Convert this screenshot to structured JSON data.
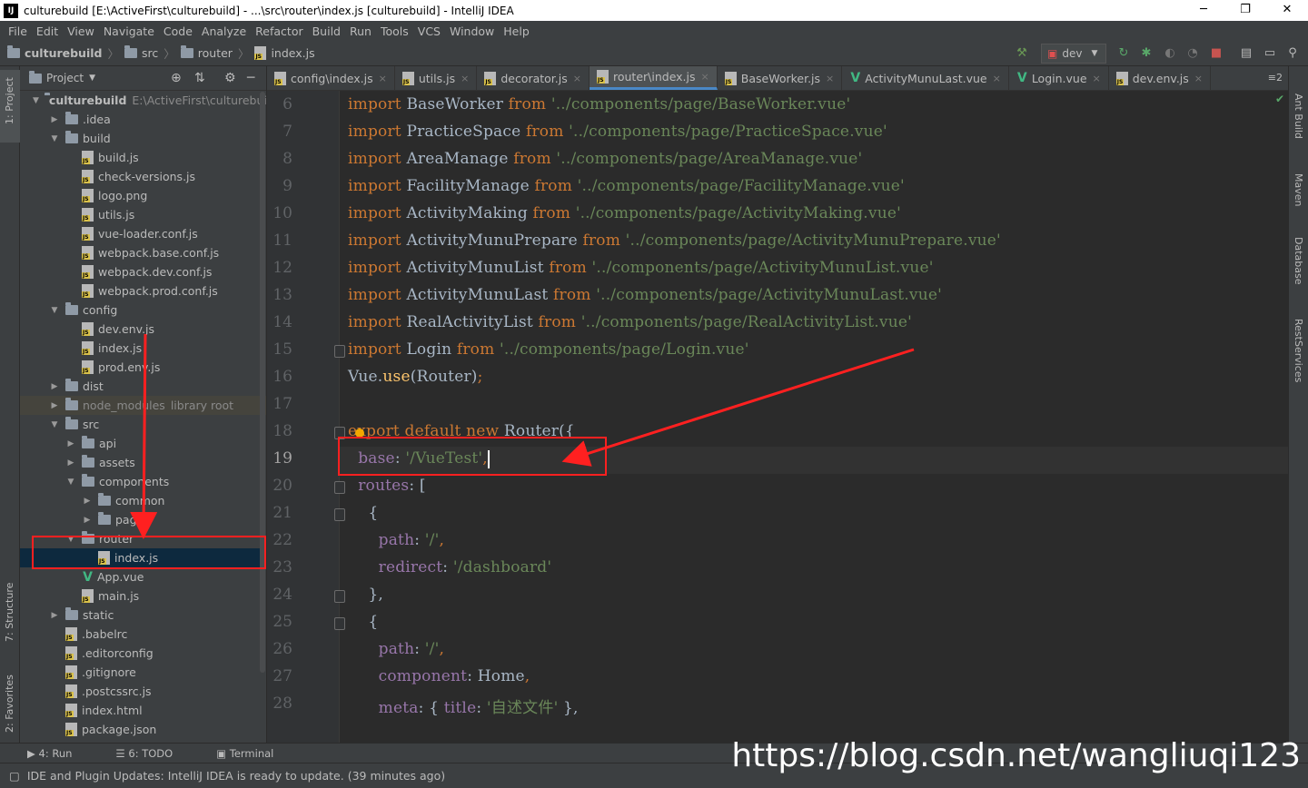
{
  "window": {
    "title": "culturebuild [E:\\ActiveFirst\\culturebuild] - ...\\src\\router\\index.js [culturebuild] - IntelliJ IDEA",
    "app_icon": "IJ",
    "controls": {
      "minimize": "─",
      "maximize": "❐",
      "close": "✕"
    }
  },
  "menu": [
    "File",
    "Edit",
    "View",
    "Navigate",
    "Code",
    "Analyze",
    "Refactor",
    "Build",
    "Run",
    "Tools",
    "VCS",
    "Window",
    "Help"
  ],
  "breadcrumb": [
    "culturebuild",
    "src",
    "router",
    "index.js"
  ],
  "run_config": {
    "label": "dev"
  },
  "left_stripe": {
    "project_tab": "1: Project",
    "structure_tab": "7: Structure",
    "favorites_tab": "2: Favorites"
  },
  "right_stripe": [
    "Ant Build",
    "Maven",
    "Database",
    "RestServices"
  ],
  "project_panel": {
    "title": "Project",
    "tree": [
      {
        "label": "culturebuild",
        "extra": "E:\\ActiveFirst\\culturebuild",
        "depth": 0,
        "kind": "folder",
        "arrow": "▼"
      },
      {
        "label": ".idea",
        "depth": 1,
        "kind": "folder",
        "arrow": "▶"
      },
      {
        "label": "build",
        "depth": 1,
        "kind": "folder",
        "arrow": "▼"
      },
      {
        "label": "build.js",
        "depth": 2,
        "kind": "js"
      },
      {
        "label": "check-versions.js",
        "depth": 2,
        "kind": "js"
      },
      {
        "label": "logo.png",
        "depth": 2,
        "kind": "img"
      },
      {
        "label": "utils.js",
        "depth": 2,
        "kind": "js"
      },
      {
        "label": "vue-loader.conf.js",
        "depth": 2,
        "kind": "js"
      },
      {
        "label": "webpack.base.conf.js",
        "depth": 2,
        "kind": "js"
      },
      {
        "label": "webpack.dev.conf.js",
        "depth": 2,
        "kind": "js"
      },
      {
        "label": "webpack.prod.conf.js",
        "depth": 2,
        "kind": "js"
      },
      {
        "label": "config",
        "depth": 1,
        "kind": "folder",
        "arrow": "▼"
      },
      {
        "label": "dev.env.js",
        "depth": 2,
        "kind": "js"
      },
      {
        "label": "index.js",
        "depth": 2,
        "kind": "js"
      },
      {
        "label": "prod.env.js",
        "depth": 2,
        "kind": "js"
      },
      {
        "label": "dist",
        "depth": 1,
        "kind": "folder",
        "arrow": "▶"
      },
      {
        "label": "node_modules",
        "extra": "library root",
        "depth": 1,
        "kind": "folder",
        "arrow": "▶",
        "dim": true
      },
      {
        "label": "src",
        "depth": 1,
        "kind": "folder",
        "arrow": "▼"
      },
      {
        "label": "api",
        "depth": 2,
        "kind": "folder",
        "arrow": "▶"
      },
      {
        "label": "assets",
        "depth": 2,
        "kind": "folder",
        "arrow": "▶"
      },
      {
        "label": "components",
        "depth": 2,
        "kind": "folder",
        "arrow": "▼"
      },
      {
        "label": "common",
        "depth": 3,
        "kind": "folder",
        "arrow": "▶"
      },
      {
        "label": "page",
        "depth": 3,
        "kind": "folder",
        "arrow": "▶"
      },
      {
        "label": "router",
        "depth": 2,
        "kind": "folder",
        "arrow": "▼"
      },
      {
        "label": "index.js",
        "depth": 3,
        "kind": "js",
        "selected": true
      },
      {
        "label": "App.vue",
        "depth": 2,
        "kind": "vue"
      },
      {
        "label": "main.js",
        "depth": 2,
        "kind": "js"
      },
      {
        "label": "static",
        "depth": 1,
        "kind": "folder",
        "arrow": "▶"
      },
      {
        "label": ".babelrc",
        "depth": 1,
        "kind": "cfg"
      },
      {
        "label": ".editorconfig",
        "depth": 1,
        "kind": "gear"
      },
      {
        "label": ".gitignore",
        "depth": 1,
        "kind": "git"
      },
      {
        "label": ".postcssrc.js",
        "depth": 1,
        "kind": "js"
      },
      {
        "label": "index.html",
        "depth": 1,
        "kind": "html"
      },
      {
        "label": "package.json",
        "depth": 1,
        "kind": "cfg"
      }
    ]
  },
  "tabs": [
    {
      "label": "config\\index.js",
      "kind": "js"
    },
    {
      "label": "utils.js",
      "kind": "js"
    },
    {
      "label": "decorator.js",
      "kind": "js"
    },
    {
      "label": "router\\index.js",
      "kind": "js",
      "active": true
    },
    {
      "label": "BaseWorker.js",
      "kind": "js"
    },
    {
      "label": "ActivityMunuLast.vue",
      "kind": "vue"
    },
    {
      "label": "Login.vue",
      "kind": "vue"
    },
    {
      "label": "dev.env.js",
      "kind": "js"
    }
  ],
  "tabs_overflow": "≡2",
  "editor": {
    "current_line": 19,
    "lines": [
      {
        "n": 6,
        "seg": [
          [
            "kw",
            "import"
          ],
          [
            "p",
            " BaseWorker "
          ],
          [
            "kw",
            "from"
          ],
          [
            "str",
            " '../components/page/BaseWorker.vue'"
          ]
        ]
      },
      {
        "n": 7,
        "seg": [
          [
            "kw",
            "import"
          ],
          [
            "p",
            " PracticeSpace "
          ],
          [
            "kw",
            "from"
          ],
          [
            "str",
            " '../components/page/PracticeSpace.vue'"
          ]
        ]
      },
      {
        "n": 8,
        "seg": [
          [
            "kw",
            "import"
          ],
          [
            "p",
            " AreaManage "
          ],
          [
            "kw",
            "from"
          ],
          [
            "str",
            " '../components/page/AreaManage.vue'"
          ]
        ]
      },
      {
        "n": 9,
        "seg": [
          [
            "kw",
            "import"
          ],
          [
            "p",
            " FacilityManage "
          ],
          [
            "kw",
            "from"
          ],
          [
            "str",
            " '../components/page/FacilityManage.vue'"
          ]
        ]
      },
      {
        "n": 10,
        "seg": [
          [
            "kw",
            "import"
          ],
          [
            "p",
            " ActivityMaking "
          ],
          [
            "kw",
            "from"
          ],
          [
            "str",
            " '../components/page/ActivityMaking.vue'"
          ]
        ]
      },
      {
        "n": 11,
        "seg": [
          [
            "kw",
            "import"
          ],
          [
            "p",
            " ActivityMunuPrepare "
          ],
          [
            "kw",
            "from"
          ],
          [
            "str",
            " '../components/page/ActivityMunuPrepare.vue'"
          ]
        ]
      },
      {
        "n": 12,
        "seg": [
          [
            "kw",
            "import"
          ],
          [
            "p",
            " ActivityMunuList "
          ],
          [
            "kw",
            "from"
          ],
          [
            "str",
            " '../components/page/ActivityMunuList.vue'"
          ]
        ]
      },
      {
        "n": 13,
        "seg": [
          [
            "kw",
            "import"
          ],
          [
            "p",
            " ActivityMunuLast "
          ],
          [
            "kw",
            "from"
          ],
          [
            "str",
            " '../components/page/ActivityMunuLast.vue'"
          ]
        ]
      },
      {
        "n": 14,
        "seg": [
          [
            "kw",
            "import"
          ],
          [
            "p",
            " RealActivityList "
          ],
          [
            "kw",
            "from"
          ],
          [
            "str",
            " '../components/page/RealActivityList.vue'"
          ]
        ]
      },
      {
        "n": 15,
        "seg": [
          [
            "kw",
            "import"
          ],
          [
            "p",
            " Login "
          ],
          [
            "kw",
            "from"
          ],
          [
            "str",
            " '../components/page/Login.vue'"
          ]
        ]
      },
      {
        "n": 16,
        "seg": [
          [
            "p",
            "Vue."
          ],
          [
            "fn",
            "use"
          ],
          [
            "p",
            "(Router)"
          ],
          [
            "kw",
            ";"
          ]
        ]
      },
      {
        "n": 17,
        "seg": []
      },
      {
        "n": 18,
        "seg": [
          [
            "kw",
            "export default new "
          ],
          [
            "p",
            "Router({"
          ]
        ]
      },
      {
        "n": 19,
        "seg": [
          [
            "p",
            "  "
          ],
          [
            "prop",
            "base"
          ],
          [
            "p",
            ": "
          ],
          [
            "str",
            "'/VueTest'"
          ],
          [
            "kw",
            ","
          ]
        ]
      },
      {
        "n": 20,
        "seg": [
          [
            "p",
            "  "
          ],
          [
            "prop",
            "routes"
          ],
          [
            "p",
            ": ["
          ]
        ]
      },
      {
        "n": 21,
        "seg": [
          [
            "p",
            "    {"
          ]
        ]
      },
      {
        "n": 22,
        "seg": [
          [
            "p",
            "      "
          ],
          [
            "prop",
            "path"
          ],
          [
            "p",
            ": "
          ],
          [
            "str",
            "'/'"
          ],
          [
            "kw",
            ","
          ]
        ]
      },
      {
        "n": 23,
        "seg": [
          [
            "p",
            "      "
          ],
          [
            "prop",
            "redirect"
          ],
          [
            "p",
            ": "
          ],
          [
            "str",
            "'/dashboard'"
          ]
        ]
      },
      {
        "n": 24,
        "seg": [
          [
            "p",
            "    },"
          ]
        ]
      },
      {
        "n": 25,
        "seg": [
          [
            "p",
            "    {"
          ]
        ]
      },
      {
        "n": 26,
        "seg": [
          [
            "p",
            "      "
          ],
          [
            "prop",
            "path"
          ],
          [
            "p",
            ": "
          ],
          [
            "str",
            "'/'"
          ],
          [
            "kw",
            ","
          ]
        ]
      },
      {
        "n": 27,
        "seg": [
          [
            "p",
            "      "
          ],
          [
            "prop",
            "component"
          ],
          [
            "p",
            ": Home"
          ],
          [
            "kw",
            ","
          ]
        ]
      },
      {
        "n": 28,
        "seg": [
          [
            "p",
            "      "
          ],
          [
            "prop",
            "meta"
          ],
          [
            "p",
            ": { "
          ],
          [
            "prop",
            "title"
          ],
          [
            "p",
            ": "
          ],
          [
            "str",
            "'自述文件'"
          ],
          [
            "p",
            " },"
          ]
        ]
      }
    ]
  },
  "tool_buttons": [
    "4: Run",
    "6: TODO",
    "Terminal"
  ],
  "status": "IDE and Plugin Updates: IntelliJ IDEA is ready to update. (39 minutes ago)",
  "watermark": "https://blog.csdn.net/wangliuqi123",
  "colors": {
    "keyword": "#cc7832",
    "string": "#6a8759",
    "property": "#9876aa",
    "annotation": "#ff2020"
  }
}
